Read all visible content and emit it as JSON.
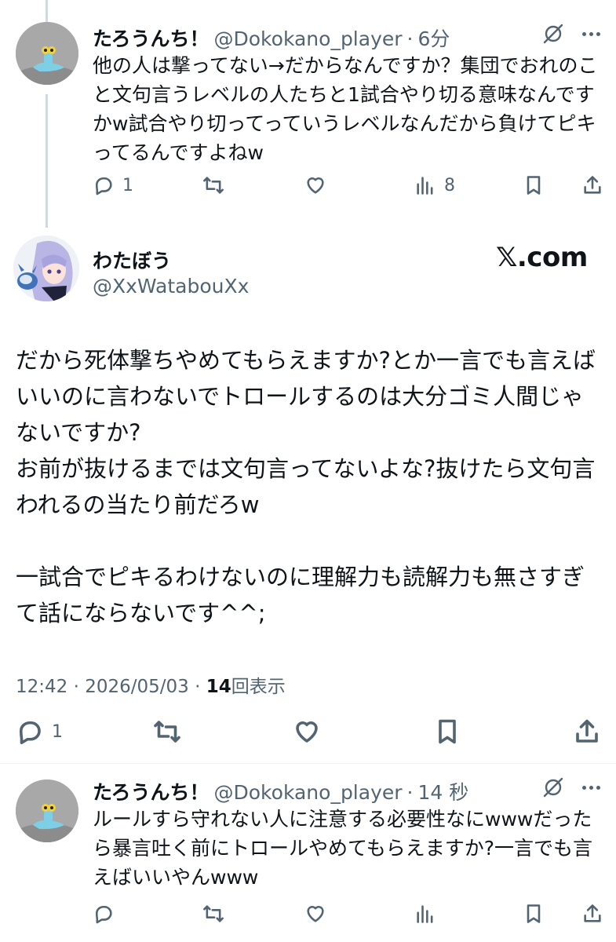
{
  "reply1": {
    "name": "たろうんち！",
    "handle": "@Dokokano_player",
    "time": "6分",
    "text": "他の人は撃ってない→だからなんですか？集団でおれのこと文句言うレベルの人たちと1試合やり切る意味なんですかw試合やり切ってっていうレベルなんだから負けてピキってるんですよねw",
    "replies": "1",
    "views": "8"
  },
  "main": {
    "name": "わたぼう",
    "handle": "@XxWatabouXx",
    "watermark": "𝕏.com",
    "text": "だから死体撃ちやめてもらえますか?とか一言でも言えばいいのに言わないでトロールするのは大分ゴミ人間じゃないですか?\nお前が抜けるまでは文句言ってないよな?抜けたら文句言われるの当たり前だろw\n\n一試合でピキるわけないのに理解力も読解力も無さすぎて話にならないです^^;",
    "time": "12:42",
    "date": "2026/05/03",
    "views_count": "14",
    "views_label": "回表示",
    "replies": "1"
  },
  "reply2": {
    "name": "たろうんち！",
    "handle": "@Dokokano_player",
    "time": "14 秒",
    "text": "ルールすら守れない人に注意する必要性なにwwwだったら暴言吐く前にトロールやめてもらえますか?一言でも言えばいいやんwww"
  },
  "icons": [
    "reply-icon",
    "retweet-icon",
    "like-icon",
    "views-icon",
    "bookmark-icon",
    "share-icon",
    "grok-icon",
    "more-icon"
  ],
  "colors": {
    "text": "#0f1419",
    "secondary": "#536471",
    "thread_line": "#cfd9de",
    "divider": "#eff3f4"
  }
}
